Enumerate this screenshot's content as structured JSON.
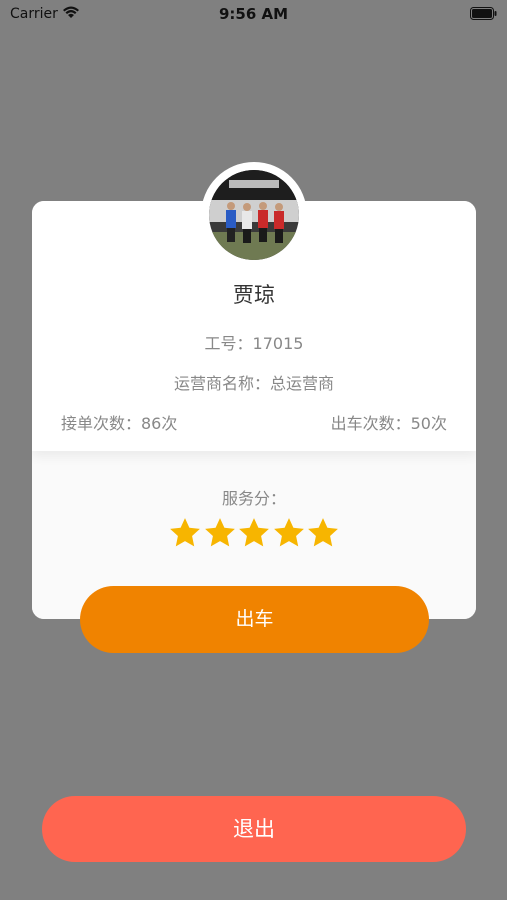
{
  "status_bar": {
    "carrier": "Carrier",
    "time": "9:56 AM"
  },
  "profile": {
    "name": "贾琼",
    "employee_id": "工号：17015",
    "operator": "运营商名称：总运营商",
    "order_count": "接单次数：86次",
    "trip_count": "出车次数：50次"
  },
  "service": {
    "label": "服务分：",
    "rating": 5,
    "max_rating": 5,
    "star_color": "#f7b500"
  },
  "actions": {
    "depart_label": "出车",
    "depart_color": "#f08300",
    "logout_label": "退出",
    "logout_color": "#ff6550"
  }
}
